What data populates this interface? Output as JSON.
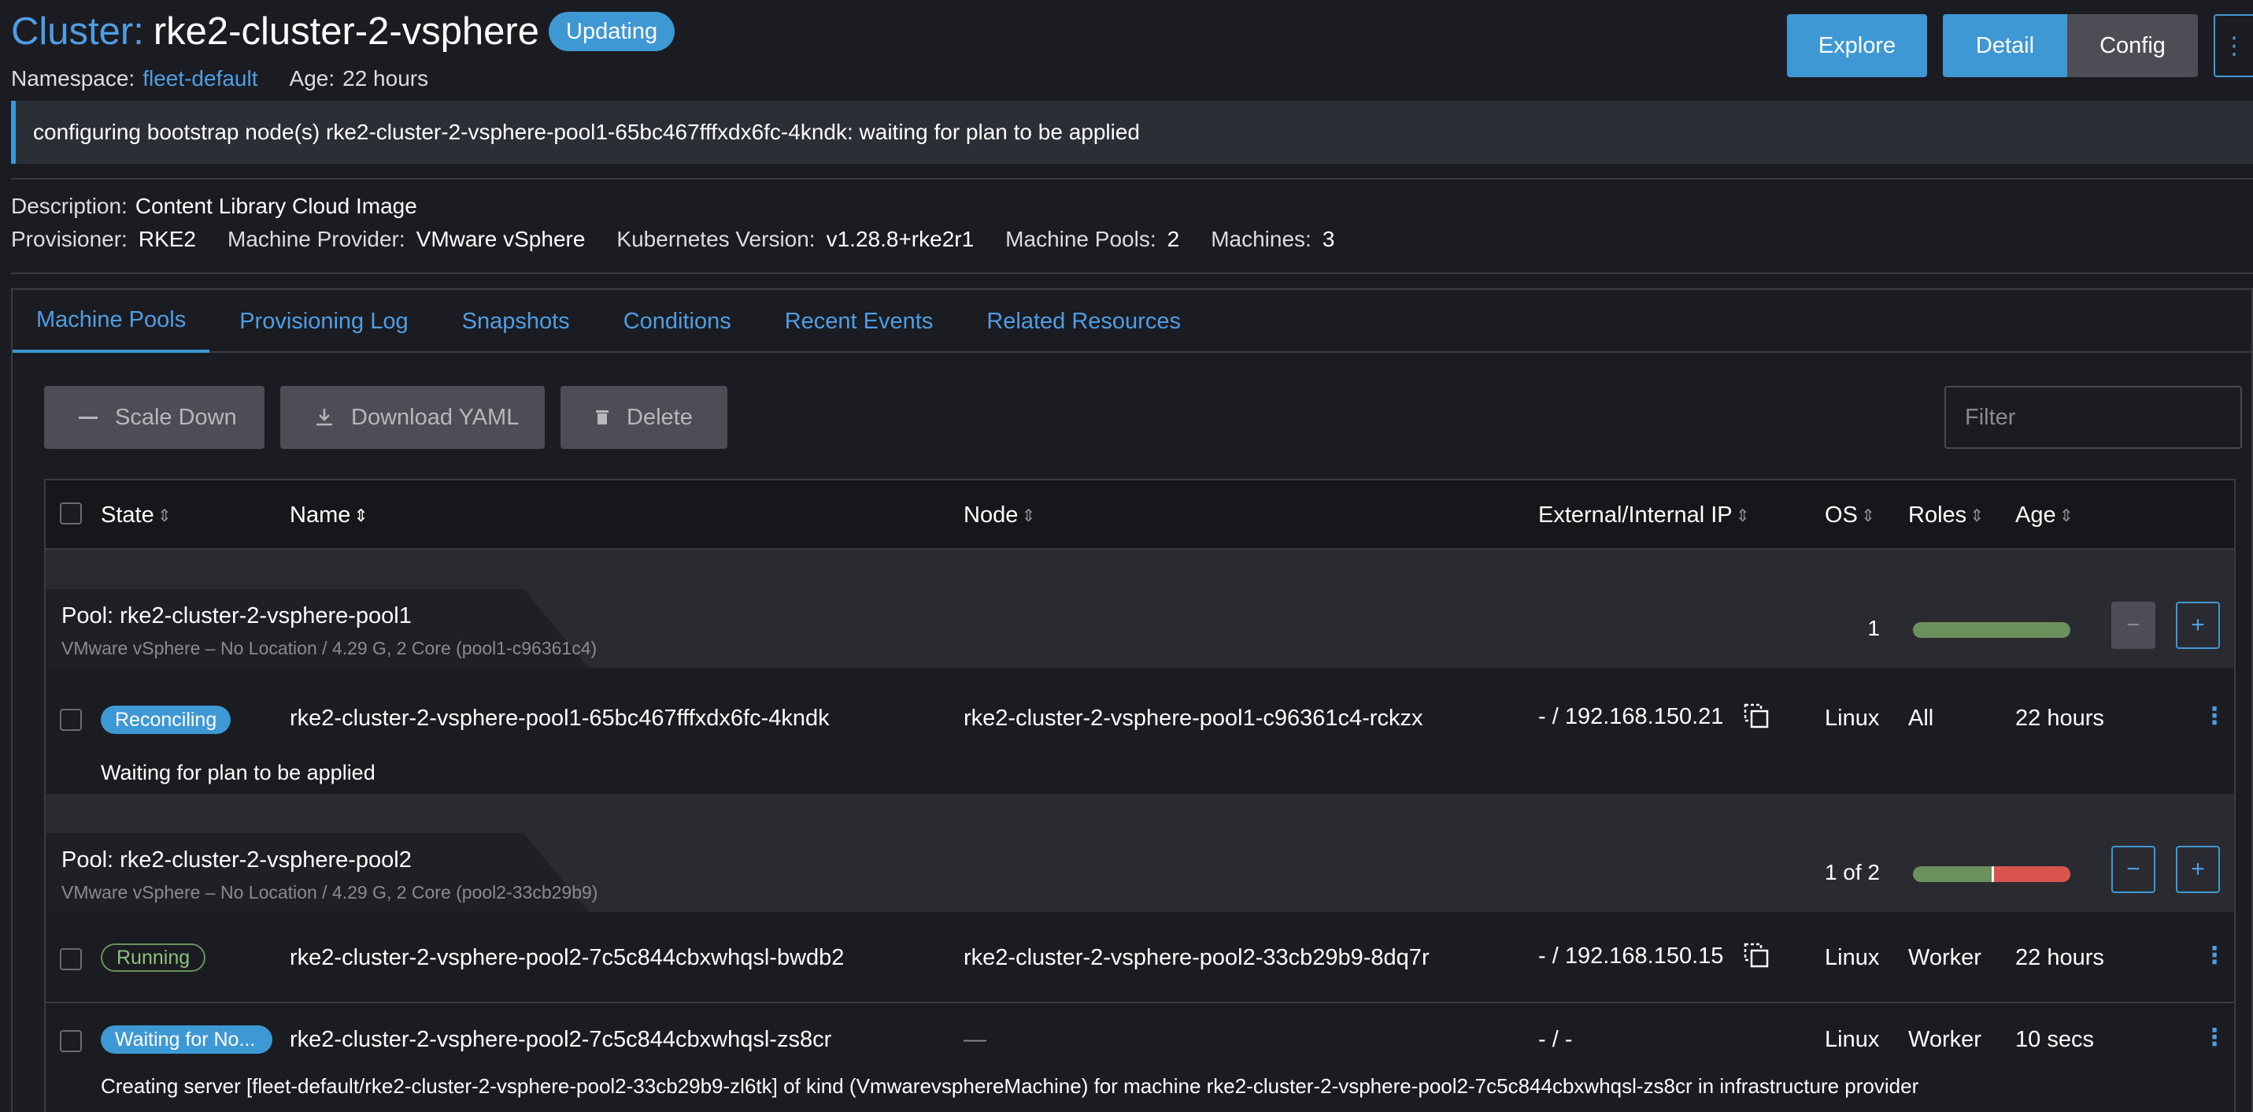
{
  "header": {
    "title_prefix": "Cluster:",
    "title_name": "rke2-cluster-2-vsphere",
    "status": "Updating",
    "namespace_label": "Namespace:",
    "namespace_value": "fleet-default",
    "age_label": "Age:",
    "age_value": "22 hours",
    "buttons": {
      "explore": "Explore",
      "detail": "Detail",
      "config": "Config",
      "more": "⋮"
    }
  },
  "banner": "configuring bootstrap node(s) rke2-cluster-2-vsphere-pool1-65bc467fffxdx6fc-4kndk: waiting for plan to be applied",
  "details": {
    "description_label": "Description:",
    "description_value": "Content Library Cloud Image",
    "provisioner_label": "Provisioner:",
    "provisioner_value": "RKE2",
    "machine_provider_label": "Machine Provider:",
    "machine_provider_value": "VMware vSphere",
    "k8s_label": "Kubernetes Version:",
    "k8s_value": "v1.28.8+rke2r1",
    "pools_label": "Machine Pools:",
    "pools_value": "2",
    "machines_label": "Machines:",
    "machines_value": "3"
  },
  "tabs": [
    {
      "label": "Machine Pools",
      "active": true
    },
    {
      "label": "Provisioning Log"
    },
    {
      "label": "Snapshots"
    },
    {
      "label": "Conditions"
    },
    {
      "label": "Recent Events"
    },
    {
      "label": "Related Resources"
    }
  ],
  "toolbar": {
    "scale_down": "Scale Down",
    "download_yaml": "Download YAML",
    "delete": "Delete",
    "filter_placeholder": "Filter"
  },
  "table": {
    "columns": [
      "State",
      "Name",
      "Node",
      "External/Internal IP",
      "OS",
      "Roles",
      "Age"
    ],
    "pools": [
      {
        "name": "Pool: rke2-cluster-2-vsphere-pool1",
        "info": "VMware vSphere – No Location / 4.29 G, 2 Core (pool1-c96361c4)",
        "count": "1",
        "ready_fraction": 1.0,
        "rows": [
          {
            "state": "Reconciling",
            "name": "rke2-cluster-2-vsphere-pool1-65bc467fffxdx6fc-4kndk",
            "node": "rke2-cluster-2-vsphere-pool1-c96361c4-rckzx",
            "ip": "- / 192.168.150.21",
            "os": "Linux",
            "roles": "All",
            "age": "22 hours",
            "message": "Waiting for plan to be applied"
          }
        ]
      },
      {
        "name": "Pool: rke2-cluster-2-vsphere-pool2",
        "info": "VMware vSphere – No Location / 4.29 G, 2 Core (pool2-33cb29b9)",
        "count": "1 of 2",
        "ready_fraction": 0.5,
        "rows": [
          {
            "state": "Running",
            "name": "rke2-cluster-2-vsphere-pool2-7c5c844cbxwhqsl-bwdb2",
            "node": "rke2-cluster-2-vsphere-pool2-33cb29b9-8dq7r",
            "ip": "- / 192.168.150.15",
            "os": "Linux",
            "roles": "Worker",
            "age": "22 hours"
          },
          {
            "state": "Waiting for No...",
            "name": "rke2-cluster-2-vsphere-pool2-7c5c844cbxwhqsl-zs8cr",
            "node": "—",
            "ip": "- / -",
            "os": "Linux",
            "roles": "Worker",
            "age": "10 secs",
            "message": "Creating server [fleet-default/rke2-cluster-2-vsphere-pool2-33cb29b9-zl6tk] of kind (VmwarevsphereMachine) for machine rke2-cluster-2-vsphere-pool2-7c5c844cbxwhqsl-zs8cr in infrastructure provider"
          }
        ]
      }
    ]
  },
  "colors": {
    "accent": "#3d98d3",
    "link": "#4f9ee3",
    "background": "#1b1c21",
    "success": "#6c8f5e",
    "error": "#d9534f"
  }
}
